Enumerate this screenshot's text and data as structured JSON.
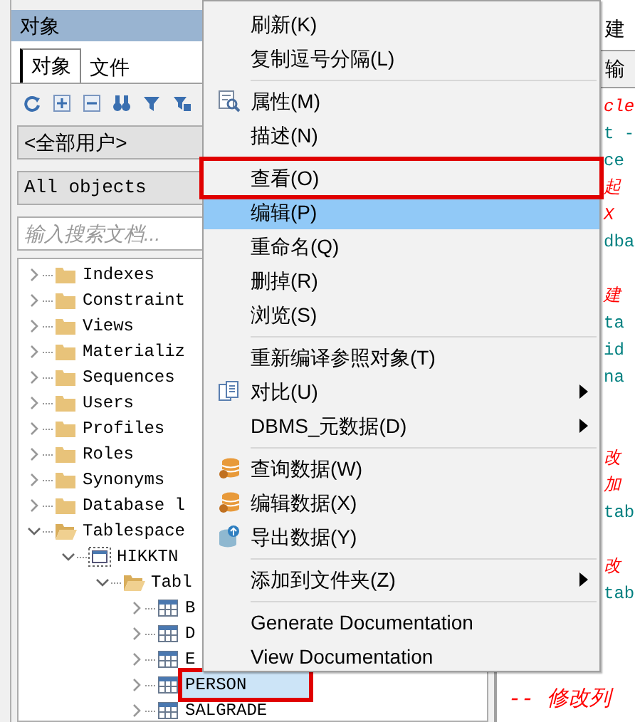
{
  "panel": {
    "title": "对象",
    "tabs": [
      {
        "label": "对象",
        "selected": true
      },
      {
        "label": "文件",
        "selected": false
      }
    ],
    "user_select": "<全部用户>",
    "type_select": "All objects",
    "search": {
      "placeholder": "输入搜索文档..."
    }
  },
  "tree": [
    {
      "label": "Indexes",
      "kind": "folder",
      "expanded": false,
      "selected": false
    },
    {
      "label": "Constraint",
      "kind": "folder",
      "expanded": false,
      "selected": false
    },
    {
      "label": "Views",
      "kind": "folder",
      "expanded": false,
      "selected": false
    },
    {
      "label": "Materializ",
      "kind": "folder",
      "expanded": false,
      "selected": false
    },
    {
      "label": "Sequences",
      "kind": "folder",
      "expanded": false,
      "selected": false
    },
    {
      "label": "Users",
      "kind": "folder",
      "expanded": false,
      "selected": false
    },
    {
      "label": "Profiles",
      "kind": "folder",
      "expanded": false,
      "selected": false
    },
    {
      "label": "Roles",
      "kind": "folder",
      "expanded": false,
      "selected": false
    },
    {
      "label": "Synonyms",
      "kind": "folder",
      "expanded": false,
      "selected": false
    },
    {
      "label": "Database l",
      "kind": "folder",
      "expanded": false,
      "selected": false
    },
    {
      "label": "Tablespace",
      "kind": "folder",
      "expanded": true,
      "selected": false,
      "children": [
        {
          "label": "HIKKTN",
          "kind": "tablespace",
          "expanded": true,
          "selected": false,
          "children": [
            {
              "label": "Tabl",
              "kind": "folder",
              "expanded": true,
              "selected": false,
              "children": [
                {
                  "label": "B",
                  "kind": "table",
                  "expanded": false,
                  "selected": false
                },
                {
                  "label": "D",
                  "kind": "table",
                  "expanded": false,
                  "selected": false
                },
                {
                  "label": "E",
                  "kind": "table",
                  "expanded": false,
                  "selected": false
                },
                {
                  "label": "PERSON",
                  "kind": "table",
                  "expanded": false,
                  "selected": true,
                  "marked": true
                },
                {
                  "label": "SALGRADE",
                  "kind": "table",
                  "expanded": false,
                  "selected": false
                }
              ]
            }
          ]
        }
      ]
    }
  ],
  "context_menu": [
    {
      "kind": "plain",
      "label": "刷新(K)",
      "selected": false
    },
    {
      "kind": "plain",
      "label": "复制逗号分隔(L)",
      "selected": false
    },
    {
      "kind": "separator"
    },
    {
      "kind": "properties",
      "label": "属性(M)",
      "selected": false
    },
    {
      "kind": "plain",
      "label": "描述(N)",
      "selected": false
    },
    {
      "kind": "separator"
    },
    {
      "kind": "plain",
      "label": "查看(O)",
      "selected": false,
      "marked": true
    },
    {
      "kind": "plain",
      "label": "编辑(P)",
      "selected": true
    },
    {
      "kind": "plain",
      "label": "重命名(Q)",
      "selected": false
    },
    {
      "kind": "plain",
      "label": "删掉(R)",
      "selected": false
    },
    {
      "kind": "plain",
      "label": "浏览(S)",
      "selected": false
    },
    {
      "kind": "separator"
    },
    {
      "kind": "plain",
      "label": "重新编译参照对象(T)",
      "selected": false
    },
    {
      "kind": "compare",
      "label": "对比(U)",
      "selected": false,
      "submenu": true
    },
    {
      "kind": "plain",
      "label": "DBMS_元数据(D)",
      "selected": false,
      "submenu": true
    },
    {
      "kind": "separator"
    },
    {
      "kind": "data",
      "label": "查询数据(W)",
      "selected": false
    },
    {
      "kind": "data",
      "label": "编辑数据(X)",
      "selected": false
    },
    {
      "kind": "export",
      "label": "导出数据(Y)",
      "selected": false
    },
    {
      "kind": "separator"
    },
    {
      "kind": "plain",
      "label": "添加到文件夹(Z)",
      "selected": false,
      "submenu": true
    },
    {
      "kind": "separator"
    },
    {
      "kind": "plain",
      "label": "Generate Documentation",
      "selected": false
    },
    {
      "kind": "plain",
      "label": "View Documentation",
      "selected": false
    }
  ],
  "editor": {
    "tab": "建",
    "output_tab": "输",
    "lines": [
      {
        "text": "cle",
        "kind": "comment"
      },
      {
        "text": "t -",
        "kind": "code"
      },
      {
        "text": "ce",
        "kind": "code"
      },
      {
        "text": "起",
        "kind": "comment"
      },
      {
        "text": "X",
        "kind": "comment"
      },
      {
        "text": "dba",
        "kind": "code"
      },
      {
        "kind": "blank"
      },
      {
        "text": "建",
        "kind": "comment"
      },
      {
        "text": "ta",
        "kind": "code"
      },
      {
        "text": "id",
        "kind": "code"
      },
      {
        "text": "na",
        "kind": "code"
      },
      {
        "kind": "blank"
      },
      {
        "kind": "blank"
      },
      {
        "text": "改",
        "kind": "comment"
      },
      {
        "text": "加",
        "kind": "comment"
      },
      {
        "text": "tab",
        "kind": "code"
      },
      {
        "kind": "blank"
      },
      {
        "text": "改",
        "kind": "comment"
      },
      {
        "text": "tab",
        "kind": "code"
      }
    ],
    "bottom_line": "-- 修改列"
  }
}
